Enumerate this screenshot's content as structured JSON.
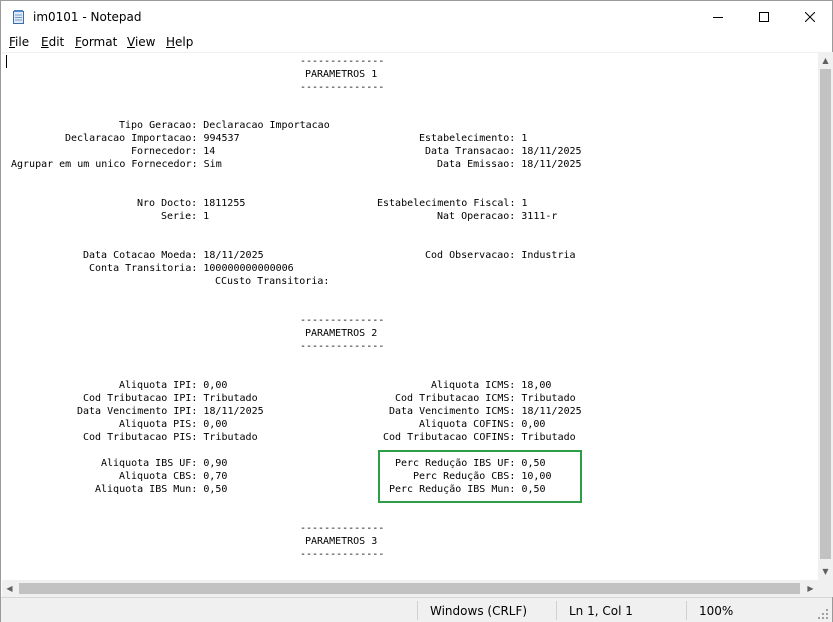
{
  "window": {
    "title": "im0101 - Notepad"
  },
  "menu": [
    {
      "underline": "F",
      "rest": "ile"
    },
    {
      "underline": "E",
      "rest": "dit"
    },
    {
      "underline": "F",
      "rest": "ormat",
      "prefix": ""
    },
    {
      "underline": "V",
      "rest": "iew"
    },
    {
      "underline": "H",
      "rest": "elp"
    }
  ],
  "menu_labels": [
    "File",
    "Edit",
    "Format",
    "View",
    "Help"
  ],
  "document": {
    "section1": {
      "dashes_top": "--------------",
      "title": "PARAMETROS 1",
      "dashes_bottom": "--------------"
    },
    "block1": {
      "tipo_geracao": "Tipo Geracao: Declaracao Importacao",
      "declaracao": "Declaracao Importacao: 994537",
      "fornecedor": "Fornecedor: 14",
      "agrupar": "Agrupar em um unico Fornecedor: Sim",
      "estabelecimento": "Estabelecimento: 1",
      "data_transacao": "Data Transacao: 18/11/2025",
      "data_emissao": "Data Emissao: 18/11/2025"
    },
    "block2": {
      "nro_docto": "Nro Docto: 1811255",
      "serie": "Serie: 1",
      "estab_fiscal": "Estabelecimento Fiscal: 1",
      "nat_operacao": "Nat Operacao: 3111-r"
    },
    "block3": {
      "data_cotacao": "Data Cotacao Moeda: 18/11/2025",
      "conta_transitoria": "Conta Transitoria: 100000000000006",
      "ccusto": "CCusto Transitoria:",
      "cod_observacao": "Cod Observacao: Industria"
    },
    "section2": {
      "dashes_top": "--------------",
      "title": "PARAMETROS 2",
      "dashes_bottom": "--------------"
    },
    "block4": {
      "aliq_ipi": "Aliquota IPI: 0,00",
      "cod_trib_ipi": "Cod Tributacao IPI: Tributado",
      "data_venc_ipi": "Data Vencimento IPI: 18/11/2025",
      "aliq_pis": "Aliquota PIS: 0,00",
      "cod_trib_pis": "Cod Tributacao PIS: Tributado",
      "aliq_icms": "Aliquota ICMS: 18,00",
      "cod_trib_icms": "Cod Tributacao ICMS: Tributado",
      "data_venc_icms": "Data Vencimento ICMS: 18/11/2025",
      "aliq_cofins": "Aliquota COFINS: 0,00",
      "cod_trib_cofins": "Cod Tributacao COFINS: Tributado"
    },
    "block5": {
      "aliq_ibs_uf": "Aliquota IBS UF: 0,90",
      "aliq_cbs": "Aliquota CBS: 0,70",
      "aliq_ibs_mun": "Aliquota IBS Mun: 0,50",
      "perc_red_ibs_uf": "Perc Redução IBS UF: 0,50",
      "perc_red_cbs": "Perc Redução CBS: 10,00",
      "perc_red_ibs_mun": "Perc Redução IBS Mun: 0,50"
    },
    "section3": {
      "dashes_top": "--------------",
      "title": "PARAMETROS 3",
      "dashes_bottom": "--------------"
    }
  },
  "status": {
    "encoding": "Windows (CRLF)",
    "position": "Ln 1, Col 1",
    "zoom": "100%"
  },
  "colors": {
    "highlight": "#2e9d48"
  },
  "icons": [
    "notepad-icon",
    "minimize-icon",
    "maximize-icon",
    "close-icon",
    "scroll-up-icon",
    "scroll-down-icon",
    "scroll-left-icon",
    "scroll-right-icon",
    "resize-grip-icon"
  ]
}
